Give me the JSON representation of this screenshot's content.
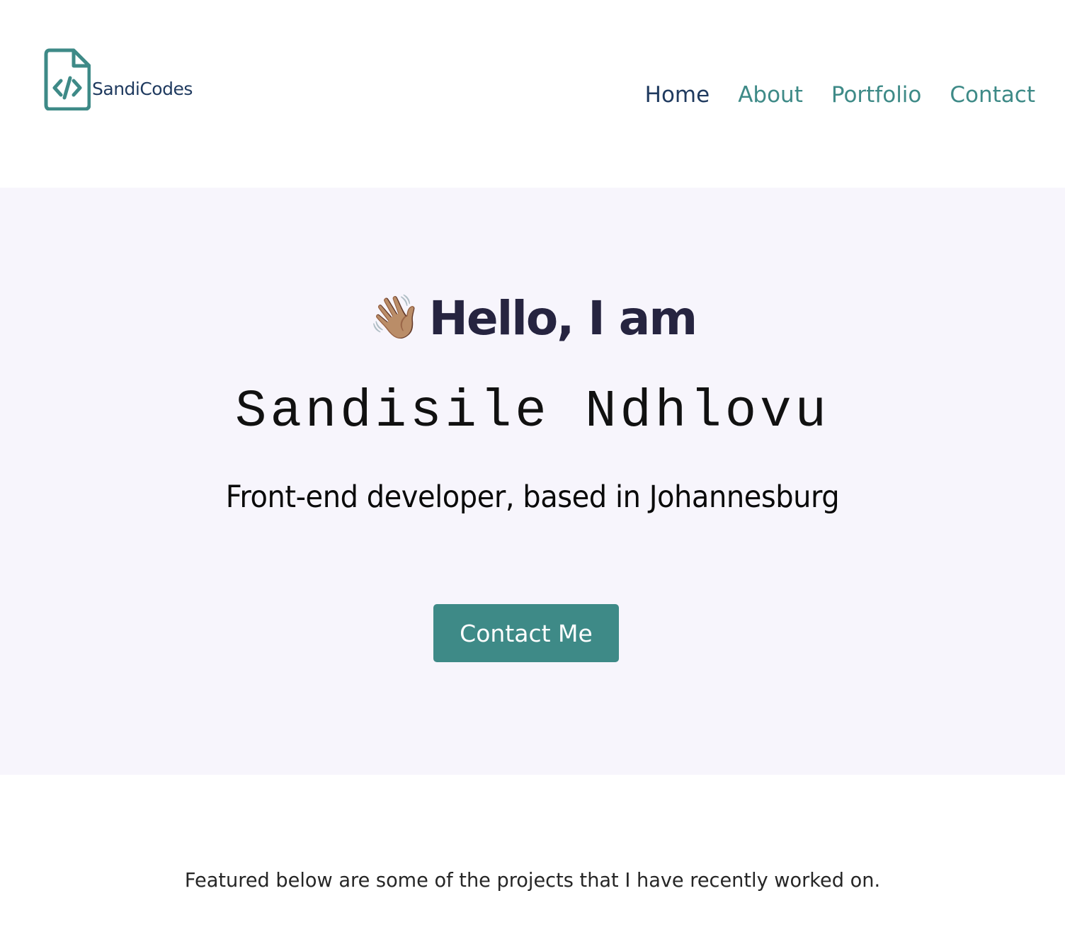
{
  "brand": {
    "logo_icon": "code-file-icon",
    "name": "SandiCodes"
  },
  "nav": {
    "items": [
      {
        "label": "Home",
        "active": true
      },
      {
        "label": "About",
        "active": false
      },
      {
        "label": "Portfolio",
        "active": false
      },
      {
        "label": "Contact",
        "active": false
      }
    ]
  },
  "hero": {
    "wave_icon": "waving-hand-icon",
    "wave_emoji": "👋🏽",
    "greeting": "Hello, I am",
    "name": "Sandisile Ndhlovu",
    "tagline": "Front-end developer, based in Johannesburg",
    "cta_label": "Contact Me"
  },
  "featured": {
    "text": "Featured below are some of the projects that I have recently worked on."
  },
  "colors": {
    "accent": "#3e8a87",
    "navy": "#1f3a5f",
    "heading": "#262440",
    "hero_bg": "#f7f5fc"
  }
}
